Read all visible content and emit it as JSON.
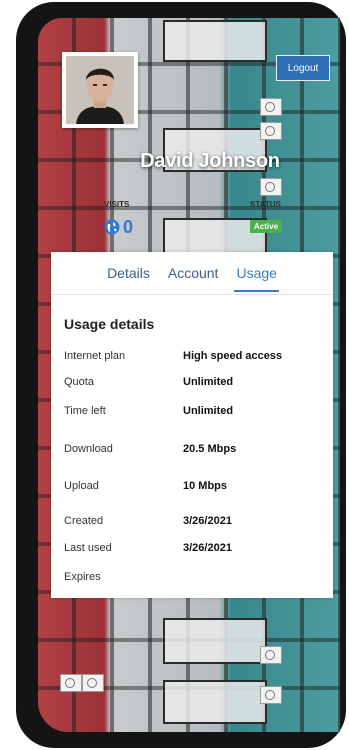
{
  "profile": {
    "name": "David Johnson",
    "visits_label": "VISITS",
    "visits_count": "0",
    "status_label": "STATUS",
    "status_value": "Active"
  },
  "header": {
    "logout_label": "Logout"
  },
  "tabs": [
    {
      "label": "Details",
      "active": false
    },
    {
      "label": "Account",
      "active": false
    },
    {
      "label": "Usage",
      "active": true
    }
  ],
  "usage": {
    "title": "Usage details",
    "rows": [
      {
        "label": "Internet plan",
        "value": "High speed access"
      },
      {
        "label": "Quota",
        "value": "Unlimited"
      },
      {
        "label": "Time left",
        "value": "Unlimited"
      },
      {
        "label": "Download",
        "value": "20.5 Mbps"
      },
      {
        "label": "Upload",
        "value": "10 Mbps"
      },
      {
        "label": "Created",
        "value": "3/26/2021"
      },
      {
        "label": "Last used",
        "value": "3/26/2021"
      },
      {
        "label": "Expires",
        "value": ""
      }
    ]
  },
  "colors": {
    "accent": "#3b7cc7",
    "logout_button": "#2f6fb5",
    "status_active": "#4caf50",
    "phone_frame": "#141414"
  },
  "icons": {
    "visits": "globe-icon"
  }
}
